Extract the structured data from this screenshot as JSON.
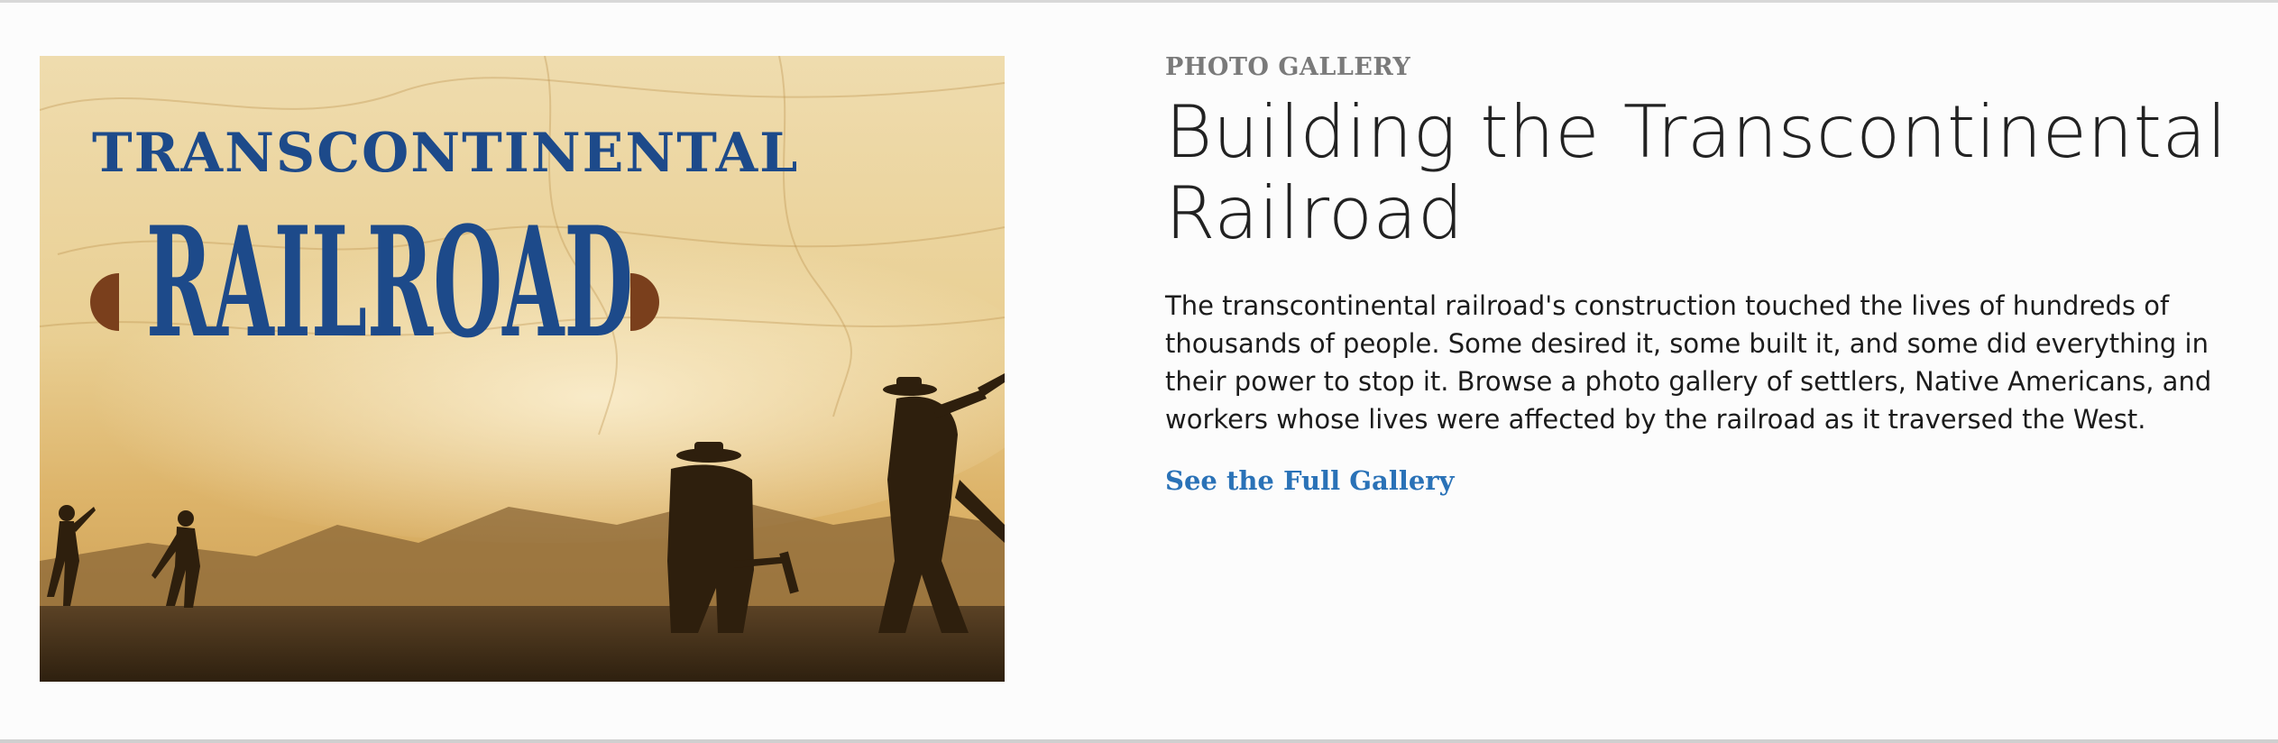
{
  "gallery": {
    "eyebrow": "PHOTO GALLERY",
    "title": "Building the Transcontinental Railroad",
    "description": "The transcontinental railroad's construction touched the lives of hundreds of thousands of people. Some desired it, some built it, and some did everything in their power to stop it. Browse a photo gallery of settlers, Native Americans, and workers whose lives were affected by the railroad as it traversed the West.",
    "cta_label": "See the Full Gallery"
  },
  "image": {
    "headline_top": "TRANSCONTINENTAL",
    "headline_main": "RAILROAD",
    "logo_color": "#1d4a8a",
    "tone_color": "#d8b06a"
  },
  "colors": {
    "link": "#2a72b7",
    "eyebrow": "#7a7a7a",
    "title": "#222222"
  }
}
